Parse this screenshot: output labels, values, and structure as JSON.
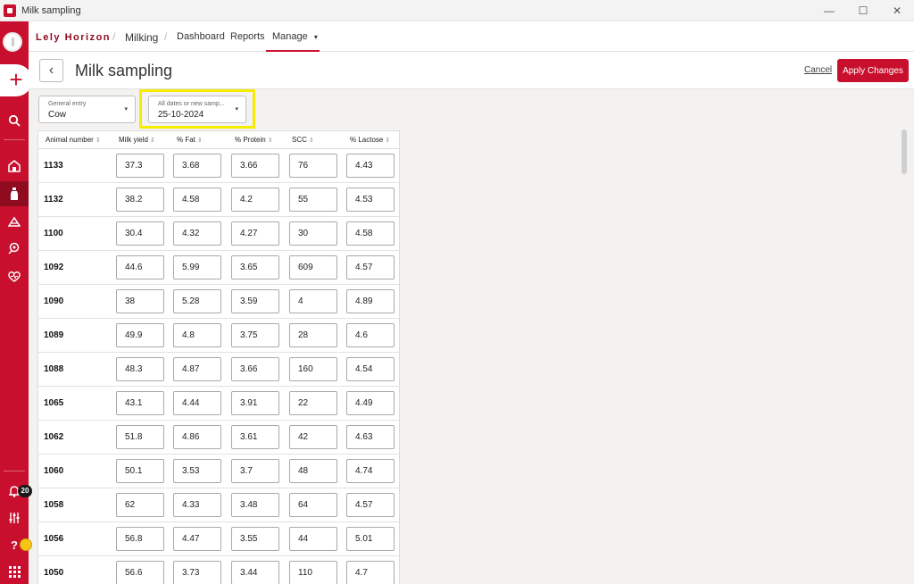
{
  "window": {
    "title": "Milk sampling",
    "controls": {
      "minimize": "—",
      "maximize": "☐",
      "close": "✕"
    }
  },
  "sidebar": {
    "plus_label": "+",
    "icons": [
      "search-icon",
      "barn-icon",
      "milk-bottle-icon",
      "feeding-icon",
      "analysis-icon",
      "health-icon",
      "bell-icon",
      "settings-sliders-icon",
      "help-icon",
      "apps-grid-icon"
    ],
    "notification_count": "20",
    "help_label": "?"
  },
  "topnav": {
    "brand": "Lely Horizon",
    "breadcrumb": "Milking",
    "items": [
      "Dashboard",
      "Reports",
      "Manage"
    ],
    "manage_caret": "▾"
  },
  "page": {
    "title": "Milk sampling",
    "back_symbol": "‹",
    "cancel_label": "Cancel",
    "apply_label": "Apply Changes"
  },
  "filters": {
    "entry": {
      "label": "General entry",
      "value": "Cow",
      "arrow": "▾"
    },
    "date": {
      "label": "All dates or new samp...",
      "value": "25-10-2024",
      "arrow": "▾"
    }
  },
  "table": {
    "headers": [
      "Animal number",
      "Milk yield",
      "% Fat",
      "% Protein",
      "SCC",
      "% Lactose"
    ],
    "sort_symbol": "⇕",
    "rows": [
      {
        "id": "1133",
        "values": [
          "37.3",
          "3.68",
          "3.66",
          "76",
          "4.43"
        ]
      },
      {
        "id": "1132",
        "values": [
          "38.2",
          "4.58",
          "4.2",
          "55",
          "4.53"
        ]
      },
      {
        "id": "1100",
        "values": [
          "30.4",
          "4.32",
          "4.27",
          "30",
          "4.58"
        ]
      },
      {
        "id": "1092",
        "values": [
          "44.6",
          "5.99",
          "3.65",
          "609",
          "4.57"
        ]
      },
      {
        "id": "1090",
        "values": [
          "38",
          "5.28",
          "3.59",
          "4",
          "4.89"
        ]
      },
      {
        "id": "1089",
        "values": [
          "49.9",
          "4.8",
          "3.75",
          "28",
          "4.6"
        ]
      },
      {
        "id": "1088",
        "values": [
          "48.3",
          "4.87",
          "3.66",
          "160",
          "4.54"
        ]
      },
      {
        "id": "1065",
        "values": [
          "43.1",
          "4.44",
          "3.91",
          "22",
          "4.49"
        ]
      },
      {
        "id": "1062",
        "values": [
          "51.8",
          "4.86",
          "3.61",
          "42",
          "4.63"
        ]
      },
      {
        "id": "1060",
        "values": [
          "50.1",
          "3.53",
          "3.7",
          "48",
          "4.74"
        ]
      },
      {
        "id": "1058",
        "values": [
          "62",
          "4.33",
          "3.48",
          "64",
          "4.57"
        ]
      },
      {
        "id": "1056",
        "values": [
          "56.8",
          "4.47",
          "3.55",
          "44",
          "5.01"
        ]
      },
      {
        "id": "1050",
        "values": [
          "56.6",
          "3.73",
          "3.44",
          "110",
          "4.7"
        ]
      }
    ]
  },
  "colors": {
    "brand_red": "#c8102e",
    "highlight": "#f5ec00"
  }
}
